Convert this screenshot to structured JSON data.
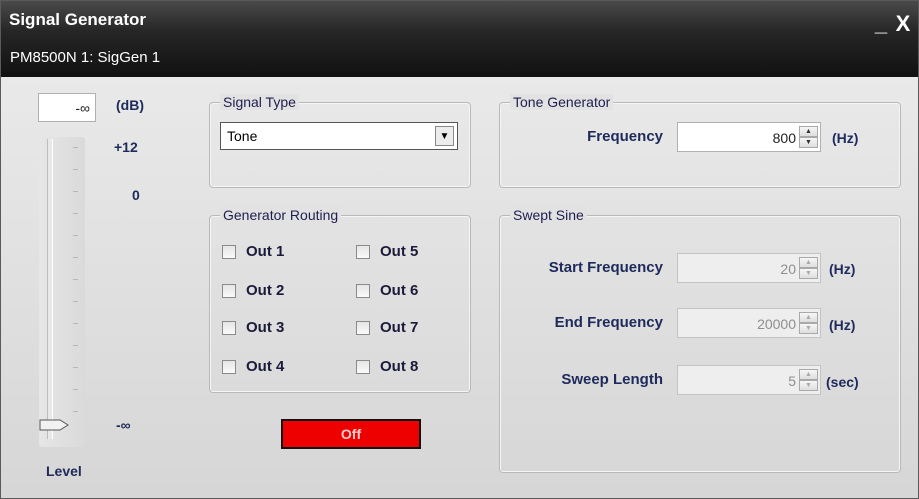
{
  "window": {
    "title": "Signal Generator",
    "subtitle": "PM8500N 1: SigGen 1",
    "minimize_glyph": "_",
    "close_glyph": "X"
  },
  "level": {
    "value": "-∞",
    "unit": "(dB)",
    "scale_top": "+12",
    "scale_zero": "0",
    "scale_bottom": "-∞",
    "label": "Level"
  },
  "signal_type": {
    "title": "Signal Type",
    "selected": "Tone"
  },
  "routing": {
    "title": "Generator Routing",
    "outputs": [
      "Out 1",
      "Out 2",
      "Out 3",
      "Out 4",
      "Out 5",
      "Out 6",
      "Out 7",
      "Out 8"
    ]
  },
  "output_button": {
    "label": "Off",
    "color": "#ee0000"
  },
  "tone": {
    "title": "Tone Generator",
    "frequency_label": "Frequency",
    "frequency_value": "800",
    "frequency_unit": "(Hz)"
  },
  "swept": {
    "title": "Swept Sine",
    "start_label": "Start Frequency",
    "start_value": "20",
    "start_unit": "(Hz)",
    "end_label": "End Frequency",
    "end_value": "20000",
    "end_unit": "(Hz)",
    "length_label": "Sweep Length",
    "length_value": "5",
    "length_unit": "(sec)"
  }
}
